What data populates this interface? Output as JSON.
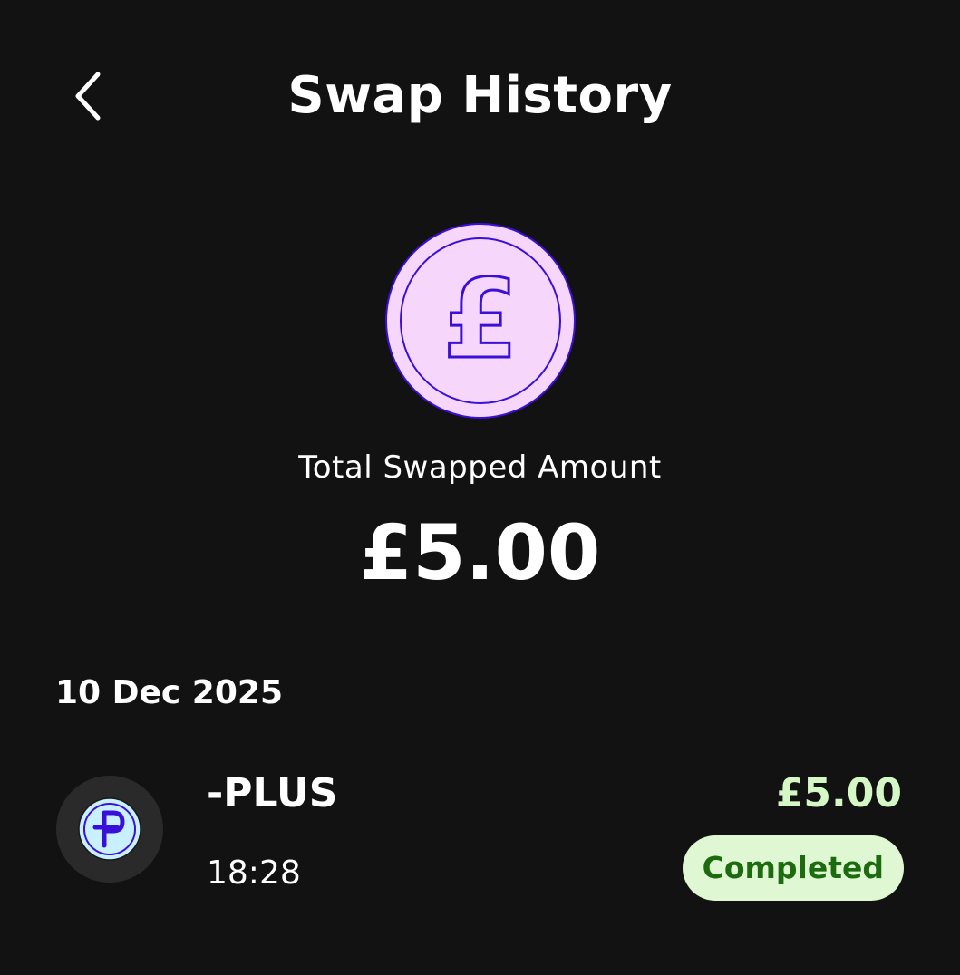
{
  "header": {
    "title": "Swap History",
    "back_icon": "chevron-left-icon"
  },
  "summary": {
    "coin_icon": "pound-coin-icon",
    "label": "Total Swapped Amount",
    "amount": "£5.00"
  },
  "groups": [
    {
      "date": "10 Dec 2025",
      "items": [
        {
          "token_icon": "plus-token-icon",
          "token_name": "PLUS",
          "time": "18:28",
          "amount": "£5.00",
          "status": "Completed"
        }
      ]
    }
  ],
  "colors": {
    "background": "#121212",
    "coin_fill": "#f7d6fb",
    "coin_outline": "#3a10d8",
    "amount_positive": "#d4f7c5",
    "badge_bg": "#dff8d3",
    "badge_text": "#1c6b0f",
    "token_bg": "#2a2a2a",
    "token_fill": "#c9f0ff"
  }
}
